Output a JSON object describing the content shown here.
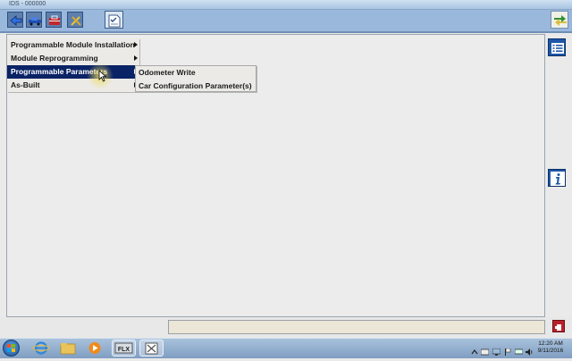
{
  "window": {
    "title": "IDS - 000000"
  },
  "toolbar": {
    "buttons": [
      {
        "icon": "back-arrow-icon"
      },
      {
        "icon": "car-icon"
      },
      {
        "icon": "toolbox-icon"
      },
      {
        "icon": "tools-icon"
      },
      {
        "icon": "tasks-checklist-icon"
      }
    ],
    "right_icon": "exchange-arrows-icon"
  },
  "menu": {
    "items": [
      {
        "label": "Programmable Module Installation",
        "has_submenu": true
      },
      {
        "label": "Module Reprogramming",
        "has_submenu": true
      },
      {
        "label": "Programmable Parameters",
        "has_submenu": true,
        "active": true
      },
      {
        "label": "As-Built",
        "has_submenu": true
      }
    ],
    "submenu": [
      {
        "label": "Odometer Write",
        "has_submenu": false
      },
      {
        "label": "Car Configuration Parameter(s)",
        "has_submenu": false
      }
    ]
  },
  "side": {
    "list_icon": "list-icon",
    "info_icon": "info-icon"
  },
  "status": {
    "message": "",
    "icon": "exit-icon"
  },
  "taskbar": {
    "apps": [
      "internet-explorer-icon",
      "file-explorer-icon",
      "media-player-icon",
      "ids-flx-icon",
      "ids-tool-icon"
    ],
    "time": "12:20 AM",
    "date": "9/11/2016"
  },
  "colors": {
    "accent": "#0a2366",
    "toolbar": "#9ab8dc",
    "side_button": "#1e56a8"
  }
}
